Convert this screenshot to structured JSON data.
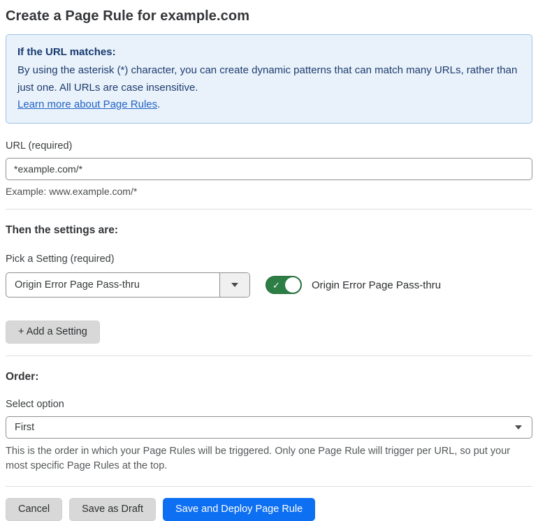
{
  "page": {
    "title": "Create a Page Rule for example.com"
  },
  "info_box": {
    "heading": "If the URL matches:",
    "body": "By using the asterisk (*) character, you can create dynamic patterns that can match many URLs, rather than just one. All URLs are case insensitive.",
    "link_label": "Learn more about Page Rules",
    "link_suffix": "."
  },
  "url_field": {
    "label": "URL (required)",
    "value": "*example.com/*",
    "example": "Example: www.example.com/*"
  },
  "settings_section": {
    "heading": "Then the settings are:",
    "picker_label": "Pick a Setting (required)",
    "picker_value": "Origin Error Page Pass-thru",
    "toggle_state": "on",
    "toggle_check_glyph": "✓",
    "toggle_label": "Origin Error Page Pass-thru",
    "add_button_label": "+ Add a Setting"
  },
  "order_section": {
    "heading": "Order:",
    "select_label": "Select option",
    "select_value": "First",
    "help_text": "This is the order in which your Page Rules will be triggered. Only one Page Rule will trigger per URL, so put your most specific Page Rules at the top."
  },
  "footer": {
    "cancel_label": "Cancel",
    "save_draft_label": "Save as Draft",
    "save_deploy_label": "Save and Deploy Page Rule"
  },
  "colors": {
    "accent_blue": "#0d6ff2",
    "info_background": "#e9f2fb",
    "info_border": "#9fc2e4",
    "info_text": "#1e3c6e",
    "link_blue": "#2161c4",
    "toggle_green": "#2d7e44",
    "button_gray": "#d8d8d8"
  }
}
